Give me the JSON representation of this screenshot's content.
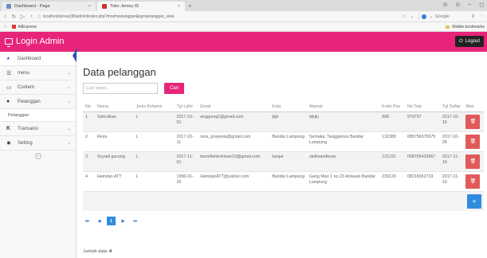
{
  "browser": {
    "tabs": [
      {
        "title": "Dashboard - Page",
        "close": "×"
      },
      {
        "title": "Toko Jersey ID",
        "close": "×"
      }
    ],
    "new_tab": "+",
    "url": "localhost/jersey38/admin/index.php?mod=pelanggan&pg=pelanggan_view",
    "search_engine": "Google",
    "bookmarks": [
      {
        "label": "AliExpress"
      }
    ],
    "mobile_bookmarks": "Mobile bookmarks"
  },
  "header": {
    "title": "Login Admin",
    "logout": "Logout",
    "brand_color": "#e8247a"
  },
  "sidebar": {
    "items": [
      {
        "label": "Dashboard",
        "icon": "dashboard-icon"
      },
      {
        "label": "menu",
        "icon": "list-icon"
      },
      {
        "label": "Content",
        "icon": "monitor-icon"
      },
      {
        "label": "Pelanggan",
        "icon": "user-icon"
      },
      {
        "label": "Transaksi",
        "icon": "transaction-icon"
      },
      {
        "label": "Setting",
        "icon": "gear-icon"
      }
    ],
    "sub_pelanggan": "Pelanggan"
  },
  "main": {
    "title": "Data pelanggan",
    "search_placeholder": "Cari nama ..",
    "search_button": "Cari",
    "columns": [
      "No",
      "Nama",
      "Jenis Kelamin",
      "Tgl Lahir",
      "Email",
      "Kota",
      "Alamat",
      "Kode Pos",
      "No Telp",
      "Tgl Daftar",
      "Aksi"
    ],
    "rows": [
      {
        "no": "1",
        "nama": "Sahrulkan",
        "jk": "L",
        "tgl_lahir": "2017-10-01",
        "email": "anggunaj1@gmail.com",
        "kota": "jbjk",
        "alamat": "bjkjkj",
        "kode_pos": "898",
        "telp": "979797",
        "tgl_daftar": "2017-10-16"
      },
      {
        "no": "2",
        "nama": "Reza",
        "jk": "L",
        "tgl_lahir": "2017-10-11",
        "email": "reza_prayesta@gmail.com",
        "kota": "Bandar Lampung",
        "alamat": "Semaka, Tanggamus Bandar Lampung",
        "kode_pos": "132389",
        "telp": "085756575675",
        "tgl_daftar": "2017-10-28"
      },
      {
        "no": "3",
        "nama": "Suyadi gacang",
        "jk": "L",
        "tgl_lahir": "2017-11-01",
        "email": "bismillahirohman10@gmail.com",
        "kota": "banjar",
        "alamat": "skdksandknas",
        "kode_pos": "121231",
        "telp": "098765432867",
        "tgl_daftar": "2017-11-10"
      },
      {
        "no": "4",
        "nama": "Hamdan ATT",
        "jk": "L",
        "tgl_lahir": "1996-01-25",
        "email": "HamdanATT@yahoo.com",
        "kota": "Bandar Lampung",
        "alamat": "Gang Mari 1 no.23 Antasari Bandar Lampung",
        "kode_pos": "239129",
        "telp": "08218362719",
        "tgl_daftar": "2017-11-10"
      }
    ],
    "pagination": {
      "first": "⏮",
      "prev": "◀",
      "current": "1",
      "next": "▶",
      "last": "⏭"
    },
    "total_label": "Jumlah data:",
    "total_value": "4"
  }
}
